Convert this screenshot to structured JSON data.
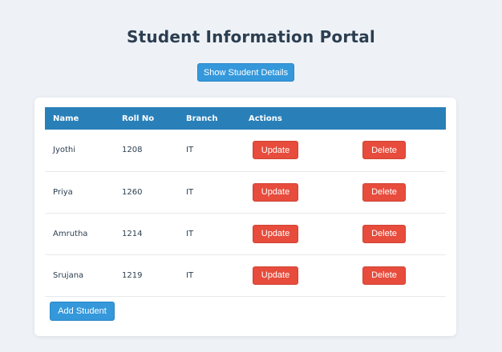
{
  "page": {
    "title": "Student Information Portal",
    "show_button_label": "Show Student Details",
    "add_button_label": "Add Student"
  },
  "table": {
    "headers": [
      "Name",
      "Roll No",
      "Branch",
      "Actions"
    ],
    "update_label": "Update",
    "delete_label": "Delete",
    "rows": [
      {
        "name": "Jyothi",
        "roll": "1208",
        "branch": "IT"
      },
      {
        "name": "Priya",
        "roll": "1260",
        "branch": "IT"
      },
      {
        "name": "Amrutha",
        "roll": "1214",
        "branch": "IT"
      },
      {
        "name": "Srujana",
        "roll": "1219",
        "branch": "IT"
      }
    ]
  },
  "colors": {
    "primary": "#3498db",
    "header": "#2980b9",
    "danger": "#e74c3c",
    "background": "#eef2f7"
  }
}
